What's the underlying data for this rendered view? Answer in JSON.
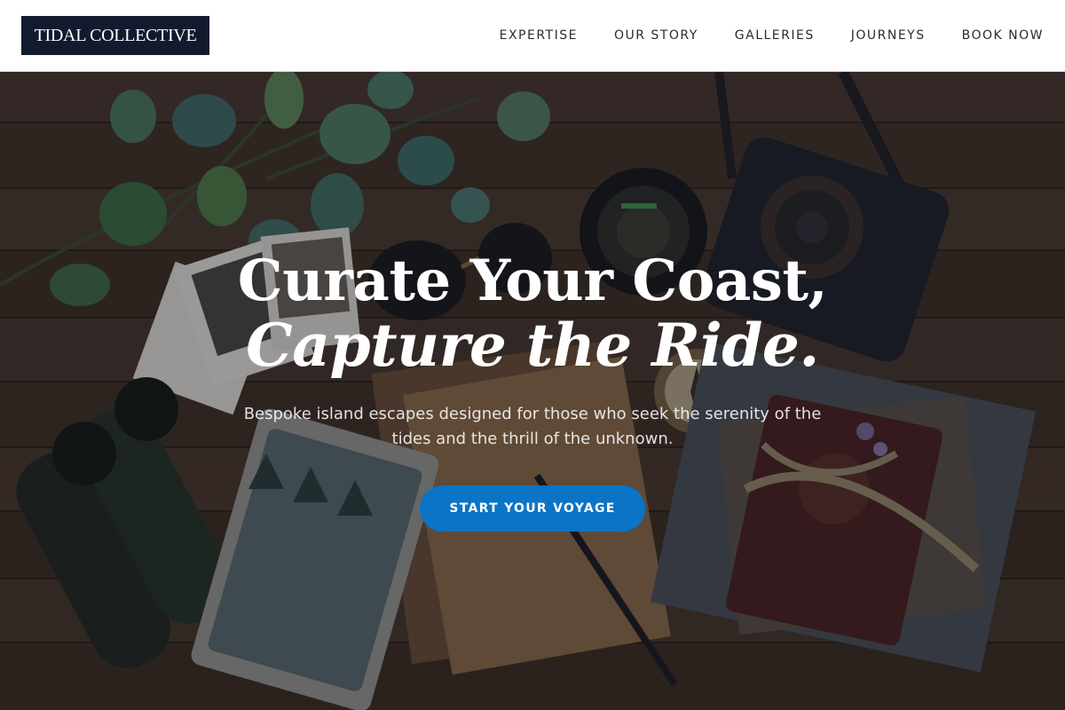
{
  "brand": {
    "logo_text": "TIDAL COLLECTIVE"
  },
  "nav": {
    "items": [
      {
        "label": "EXPERTISE"
      },
      {
        "label": "OUR STORY"
      },
      {
        "label": "GALLERIES"
      },
      {
        "label": "JOURNEYS"
      },
      {
        "label": "BOOK NOW"
      }
    ]
  },
  "hero": {
    "headline_line1": "Curate Your Coast,",
    "headline_line2": "Capture the Ride.",
    "subtitle": "Bespoke island escapes designed for those who seek the serenity of the tides and the thrill of the unknown.",
    "cta_label": "START YOUR VOYAGE",
    "background": "flat-lay of travel gear on wooden planks: eucalyptus, polaroid photos, binoculars, camera, lens, compass, notebook, map"
  },
  "colors": {
    "logo_bg": "#121a2e",
    "cta_bg": "#0b74c6",
    "header_bg": "#ffffff",
    "nav_text": "#2b2b2b"
  }
}
